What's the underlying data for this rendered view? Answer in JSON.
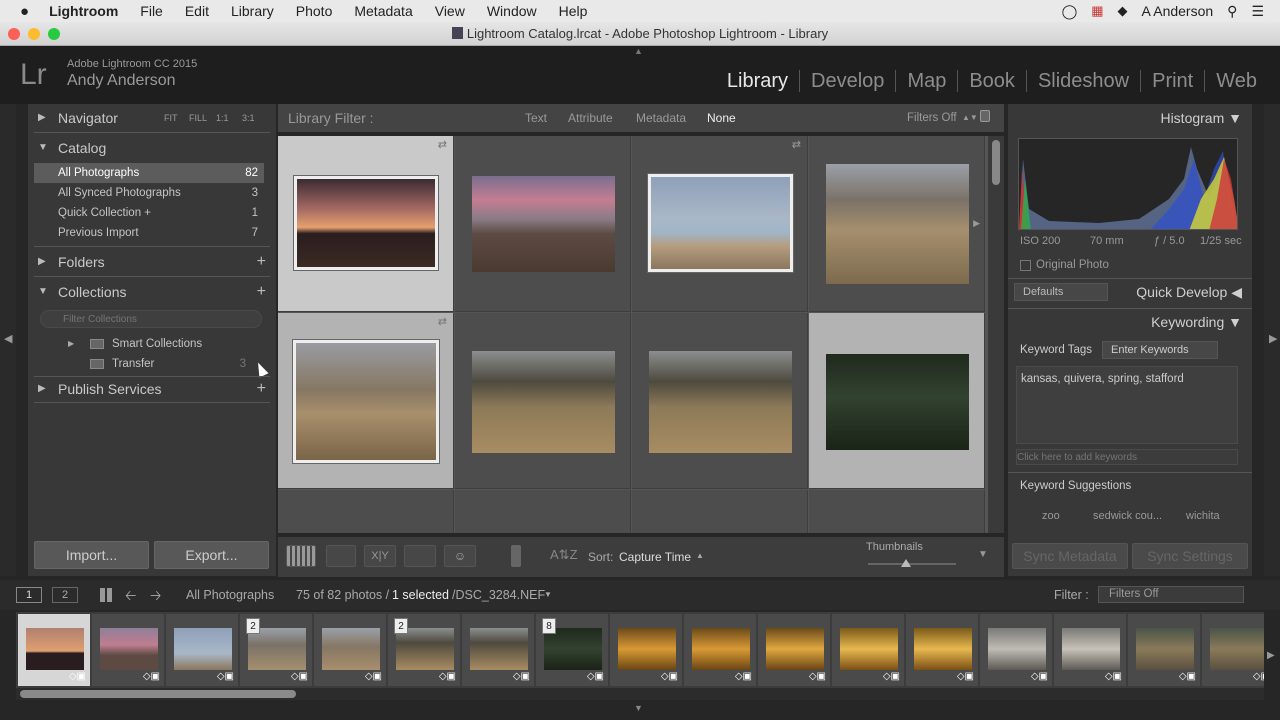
{
  "menubar": {
    "apple": "",
    "app_name": "Lightroom",
    "items": [
      "File",
      "Edit",
      "Library",
      "Photo",
      "Metadata",
      "View",
      "Window",
      "Help"
    ],
    "user": "A Anderson"
  },
  "window": {
    "title": "Lightroom Catalog.lrcat - Adobe Photoshop Lightroom - Library"
  },
  "identity": {
    "logo": "Lr",
    "version": "Adobe Lightroom CC 2015",
    "user": "Andy Anderson"
  },
  "modules": [
    "Library",
    "Develop",
    "Map",
    "Book",
    "Slideshow",
    "Print",
    "Web"
  ],
  "active_module": "Library",
  "left_panel": {
    "navigator": {
      "label": "Navigator",
      "zoom_options": [
        "FIT",
        "FILL",
        "1:1",
        "3:1"
      ]
    },
    "catalog": {
      "label": "Catalog",
      "items": [
        {
          "label": "All Photographs",
          "count": "82"
        },
        {
          "label": "All Synced Photographs",
          "count": "3"
        },
        {
          "label": "Quick Collection +",
          "count": "1"
        },
        {
          "label": "Previous Import",
          "count": "7"
        }
      ]
    },
    "folders": {
      "label": "Folders"
    },
    "collections": {
      "label": "Collections",
      "filter_placeholder": "Filter Collections",
      "items": [
        {
          "label": "Smart Collections",
          "count": ""
        },
        {
          "label": "Transfer",
          "count": "3"
        }
      ]
    },
    "publish": {
      "label": "Publish Services"
    },
    "import_label": "Import...",
    "export_label": "Export..."
  },
  "filter_bar": {
    "label": "Library Filter :",
    "options": [
      "Text",
      "Attribute",
      "Metadata",
      "None"
    ],
    "active": "None",
    "preset": "Filters Off"
  },
  "toolbar": {
    "sort_label": "Sort:",
    "sort_value": "Capture Time",
    "thumbnails_label": "Thumbnails",
    "thumbnails_size": 0.43
  },
  "right_panel": {
    "histogram": {
      "label": "Histogram",
      "iso": "ISO 200",
      "focal": "70 mm",
      "aperture": "ƒ / 5.0",
      "shutter": "1/25 sec",
      "original_photo": "Original Photo"
    },
    "quick_develop": {
      "preset": "Defaults",
      "label": "Quick Develop"
    },
    "keywording": {
      "label": "Keywording",
      "tags_label": "Keyword Tags",
      "tags_mode": "Enter Keywords",
      "keywords": "kansas, quivera, spring, stafford",
      "add_placeholder": "Click here to add keywords",
      "suggestions_label": "Keyword Suggestions",
      "suggestions": [
        "zoo",
        "sedwick cou...",
        "wichita"
      ]
    },
    "sync_metadata": "Sync Metadata",
    "sync_settings": "Sync Settings"
  },
  "filmstrip_bar": {
    "page1": "1",
    "page2": "2",
    "source": "All Photographs",
    "count_text": "75 of 82 photos /",
    "selected": "1 selected",
    "filename": "/DSC_3284.NEF",
    "filter_label": "Filter :",
    "filter_value": "Filters Off"
  },
  "filmstrip": {
    "stacks": [
      "",
      "",
      "",
      "2",
      "",
      "2",
      "",
      "8",
      "",
      "",
      "",
      "",
      "",
      "",
      "",
      "",
      ""
    ]
  }
}
